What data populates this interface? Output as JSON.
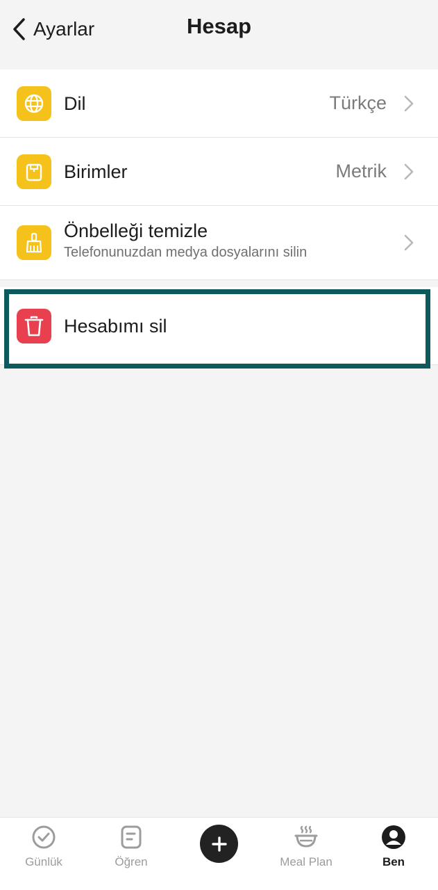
{
  "header": {
    "back_label": "Ayarlar",
    "title": "Hesap"
  },
  "settings": {
    "items": [
      {
        "label": "Dil",
        "value": "Türkçe",
        "icon": "globe-icon"
      },
      {
        "label": "Birimler",
        "value": "Metrik",
        "icon": "scale-icon"
      },
      {
        "label": "Önbelleği temizle",
        "sub": "Telefonunuzdan medya dosyalarını silin",
        "icon": "broom-icon"
      }
    ],
    "delete": {
      "label": "Hesabımı sil",
      "icon": "trash-icon"
    }
  },
  "bottom_nav": {
    "items": [
      {
        "label": "Günlük",
        "icon": "check-circle-icon"
      },
      {
        "label": "Öğren",
        "icon": "note-icon"
      },
      {
        "label": "",
        "icon": "plus-icon"
      },
      {
        "label": "Meal Plan",
        "icon": "bowl-icon"
      },
      {
        "label": "Ben",
        "icon": "profile-icon",
        "active": true
      }
    ]
  },
  "colors": {
    "accent_yellow": "#f5c21b",
    "danger_red": "#e8404f",
    "highlight": "#0c5a5c"
  }
}
